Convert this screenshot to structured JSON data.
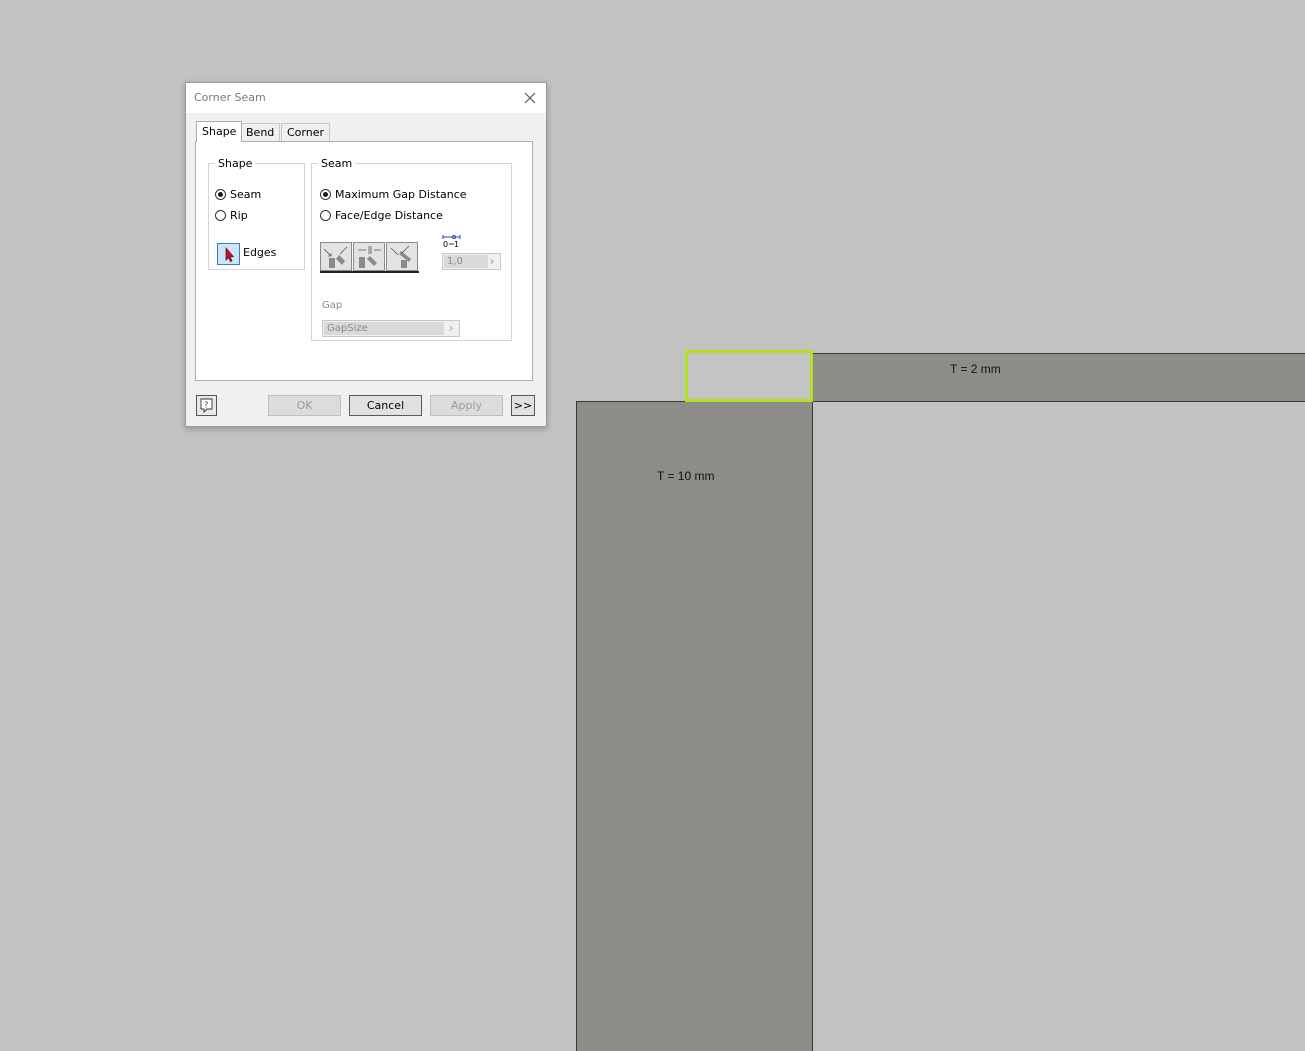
{
  "viewport": {
    "labels": {
      "top_plate": "T = 2 mm",
      "side_plate": "T = 10 mm"
    },
    "colors": {
      "background": "#c2c2c2",
      "plate": "#8d8c88",
      "highlight": "#b4e11e"
    }
  },
  "dialog": {
    "title": "Corner Seam",
    "close_icon": "close-icon",
    "tabs": [
      {
        "label": "Shape",
        "active": true
      },
      {
        "label": "Bend",
        "active": false
      },
      {
        "label": "Corner",
        "active": false
      }
    ],
    "shape_group": {
      "legend": "Shape",
      "options": [
        {
          "label": "Seam",
          "checked": true
        },
        {
          "label": "Rip",
          "checked": false
        }
      ],
      "edges_label": "Edges",
      "edges_icon": "cursor-arrow-icon"
    },
    "seam_group": {
      "legend": "Seam",
      "options": [
        {
          "label": "Maximum Gap Distance",
          "checked": true
        },
        {
          "label": "Face/Edge Distance",
          "checked": false
        }
      ],
      "seam_type_icons": [
        "seam-symmetric-icon",
        "seam-overlap-icon",
        "seam-reverse-icon"
      ],
      "ratio_icon": "ratio-0-1-icon",
      "ratio_value": "1,0",
      "gap_label": "Gap",
      "gap_value": "GapSize"
    },
    "buttons": {
      "help_icon": "help-icon",
      "ok": "OK",
      "cancel": "Cancel",
      "apply": "Apply",
      "more": ">>"
    }
  }
}
